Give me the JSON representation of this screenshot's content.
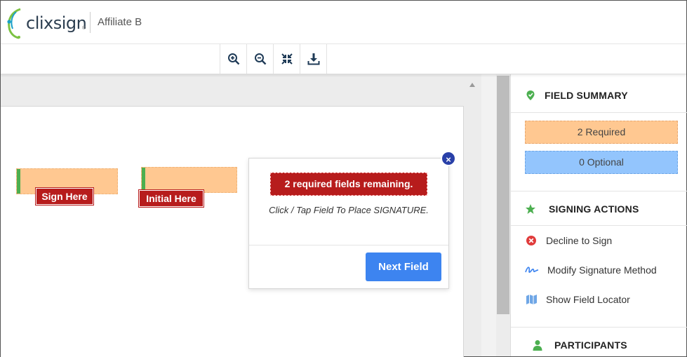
{
  "header": {
    "logo_text": "clixsign",
    "logo_reg": "®",
    "affiliate": "Affiliate B"
  },
  "toolbar": {
    "buttons": [
      {
        "icon": "zoom-in-icon"
      },
      {
        "icon": "zoom-out-icon"
      },
      {
        "icon": "fit-page-icon"
      },
      {
        "icon": "download-icon"
      }
    ]
  },
  "document": {
    "fields": [
      {
        "tag_label": "Sign Here",
        "type": "signature"
      },
      {
        "tag_label": "Initial Here",
        "type": "initial"
      }
    ]
  },
  "popover": {
    "close_label": "×",
    "alert": "2 required fields remaining.",
    "message": "Click / Tap Field To Place SIGNATURE.",
    "next_button": "Next Field"
  },
  "panel": {
    "field_summary": {
      "title": "FIELD SUMMARY",
      "required": "2 Required",
      "optional": "0 Optional"
    },
    "signing_actions": {
      "title": "SIGNING ACTIONS",
      "items": [
        {
          "label": "Decline to Sign",
          "icon": "decline-icon"
        },
        {
          "label": "Modify Signature Method",
          "icon": "signature-icon"
        },
        {
          "label": "Show Field Locator",
          "icon": "map-icon"
        }
      ]
    },
    "participants": {
      "title": "PARTICIPANTS"
    }
  },
  "colors": {
    "accent_blue": "#3d84f0",
    "alert_red": "#b71c1c",
    "required_orange": "#ffc891",
    "optional_blue": "#93c5fd",
    "green": "#4caf50"
  }
}
